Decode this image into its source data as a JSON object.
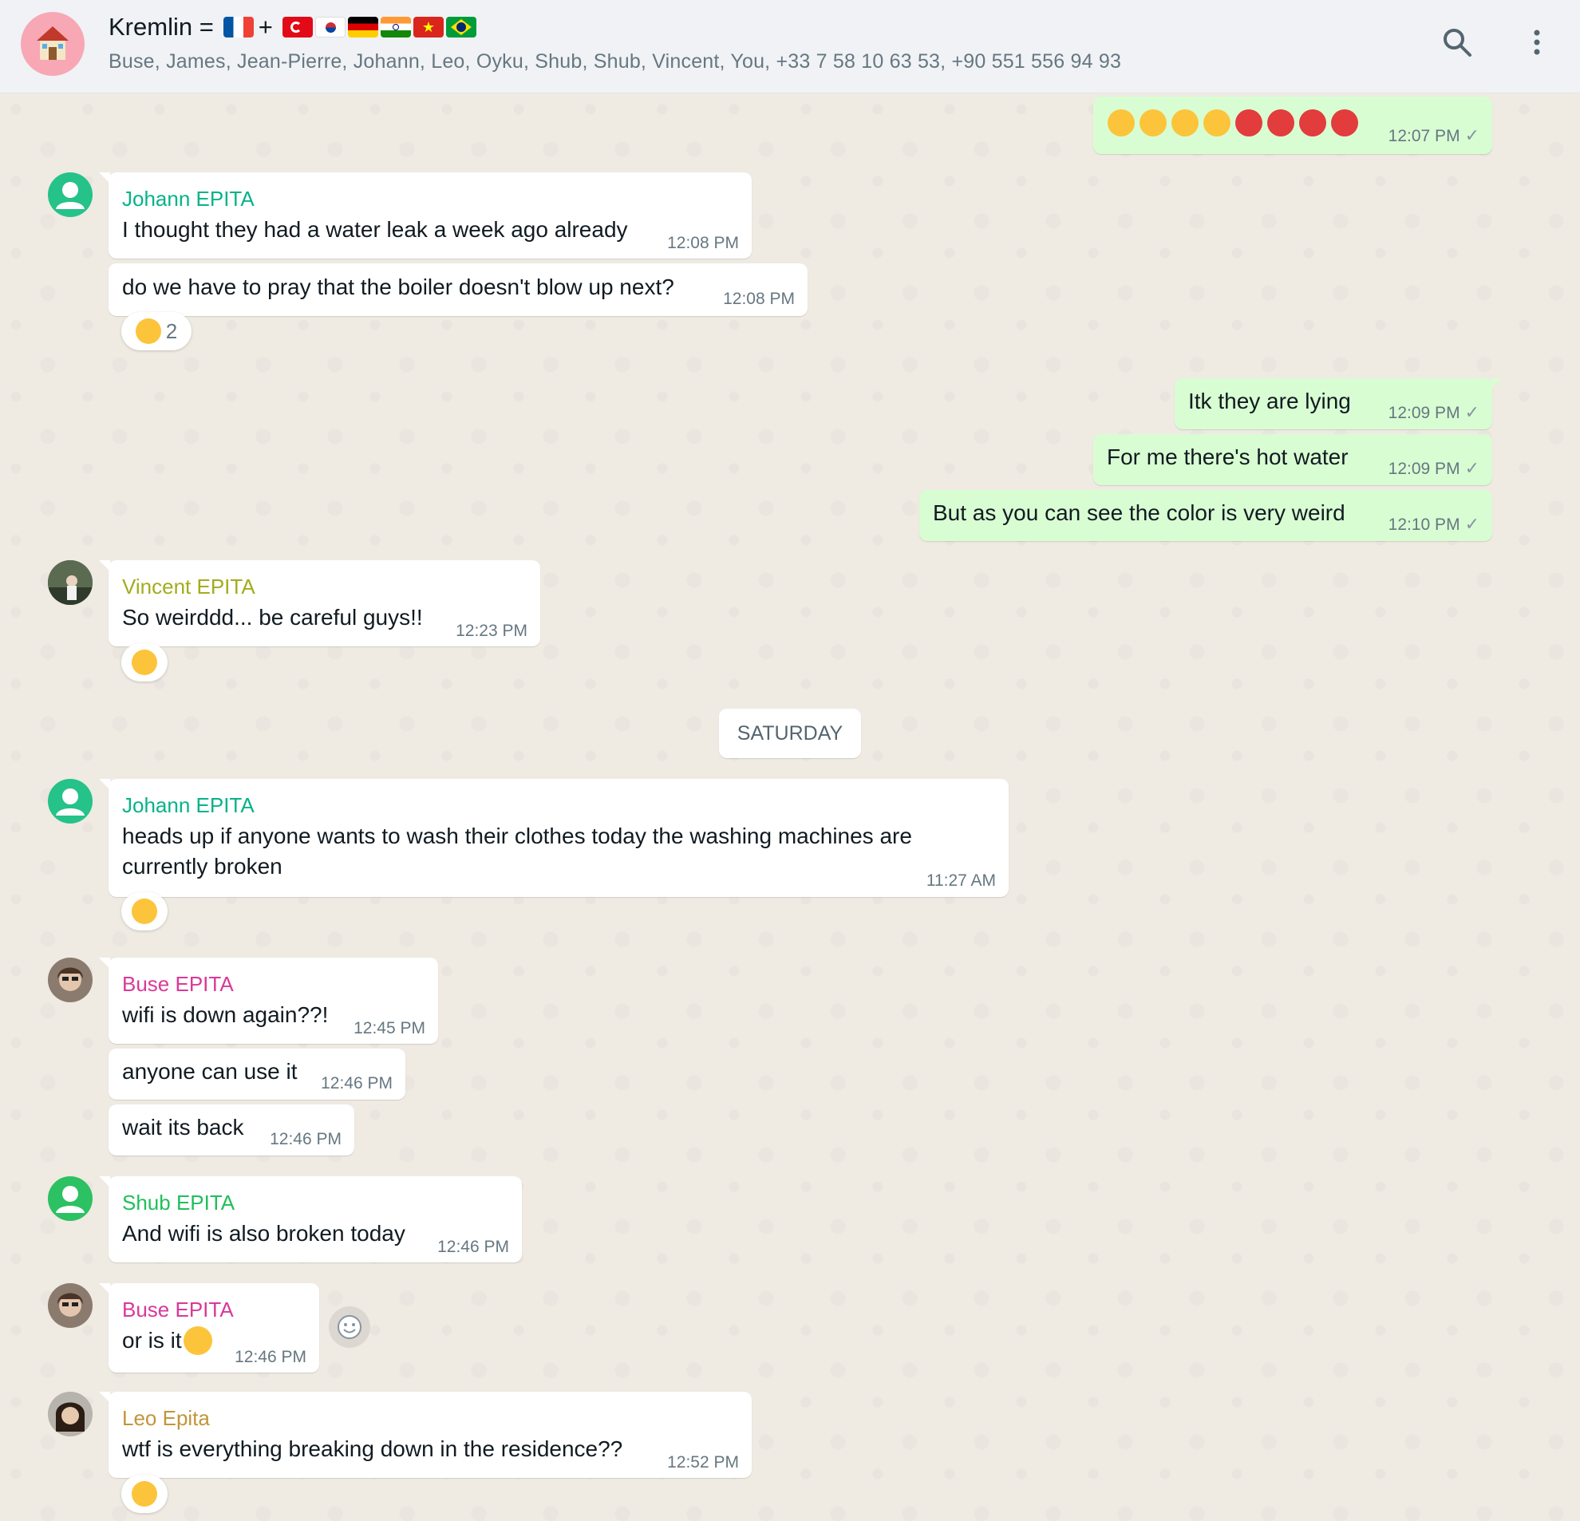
{
  "header": {
    "group_name": "Kremlin =",
    "plus": "+",
    "members": "Buse, James, Jean-Pierre, Johann, Leo, Oyku, Shub, Shub, Vincent, You, +33 7 58 10 63 53, +90 551 556 94 93",
    "icons": [
      "search-icon",
      "menu-icon"
    ]
  },
  "messages": {
    "m0": {
      "time": "12:07 PM"
    },
    "m1": {
      "sender": "Johann EPITA",
      "text": "I thought they had a water leak a week ago already",
      "time": "12:08 PM"
    },
    "m2": {
      "text": "do we have to pray that the boiler doesn't blow up next?",
      "time": "12:08 PM",
      "reaction_count": "2"
    },
    "m3": {
      "text": "Itk they are lying",
      "time": "12:09 PM"
    },
    "m4": {
      "text": "For me there's hot water",
      "time": "12:09 PM"
    },
    "m5": {
      "text": "But as you can see the color is very weird",
      "time": "12:10 PM"
    },
    "m6": {
      "sender": "Vincent EPITA",
      "text": "So weirddd... be careful guys!!",
      "time": "12:23 PM"
    },
    "date_divider": "SATURDAY",
    "m7": {
      "sender": "Johann EPITA",
      "text_line1": "heads up if anyone wants to wash their clothes today the washing machines are",
      "text_line2": "currently broken",
      "time": "11:27 AM"
    },
    "m8": {
      "sender": "Buse EPITA",
      "text": "wifi is down again??!",
      "time": "12:45 PM"
    },
    "m9": {
      "text": "anyone can use it",
      "time": "12:46 PM"
    },
    "m10": {
      "text": "wait its back",
      "time": "12:46 PM"
    },
    "m11": {
      "sender": "Shub EPITA",
      "text": "And wifi is also broken today",
      "time": "12:46 PM"
    },
    "m12": {
      "sender": "Buse EPITA",
      "text": "or is it",
      "time": "12:46 PM"
    },
    "m13": {
      "sender": "Leo Epita",
      "text": "wtf is everything breaking down in the residence??",
      "time": "12:52 PM"
    }
  },
  "colors": {
    "johann": "#06b389",
    "vincent": "#a3ac1c",
    "buse": "#d9399a",
    "shub": "#1fbf5a",
    "leo": "#c2953a",
    "outgoing_bubble": "#d9fdd3"
  }
}
